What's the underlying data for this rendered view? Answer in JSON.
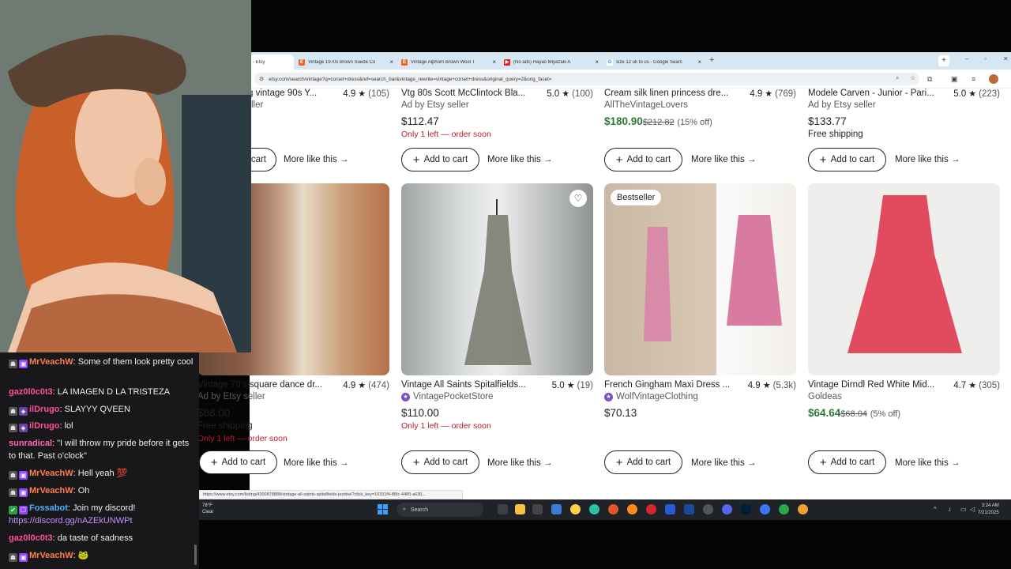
{
  "browser": {
    "tabs": [
      {
        "label": "- Etsy",
        "active": true
      },
      {
        "label": "Vintage 1970s Brown Suede Co"
      },
      {
        "label": "Vintage Alphorn Brown Wool T"
      },
      {
        "label": "(No ads) Hayao Miyazaki A"
      },
      {
        "label": "size 12 uk to us - Google Searc"
      }
    ],
    "url": "etsy.com/search/vintage?q=corset+dress&ref=search_bar&vintage_rewrite=vintage+corset+dress&original_query=2&orig_facet="
  },
  "top_row": [
    {
      "title": "g vintage 90s Y...",
      "rating": "4.9",
      "reviews": "(105)",
      "seller": "ller",
      "price": "",
      "cart": "cart",
      "more": "More like this"
    },
    {
      "title": "Vtg 80s Scott McClintock Bla...",
      "rating": "5.0",
      "reviews": "(100)",
      "seller": "Ad by Etsy seller",
      "price": "$112.47",
      "note": "Only 1 left — order soon",
      "cart": "Add to cart",
      "more": "More like this"
    },
    {
      "title": "Cream silk linen princess dre...",
      "rating": "4.9",
      "reviews": "(769)",
      "seller": "AllTheVintageLovers",
      "price": "$180.90",
      "orig": "$212.82",
      "pct": "(15% off)",
      "cart": "Add to cart",
      "more": "More like this"
    },
    {
      "title": "Modele Carven - Junior - Pari...",
      "rating": "5.0",
      "reviews": "(223)",
      "seller": "Ad by Etsy seller",
      "price": "$133.77",
      "ship": "Free shipping",
      "cart": "Add to cart",
      "more": "More like this"
    }
  ],
  "bottom_row": [
    {
      "title": "Vintage 70's square dance dr...",
      "rating": "4.9",
      "reviews": "(474)",
      "seller": "Ad by Etsy seller",
      "price": "$88.00",
      "ship": "Free shipping",
      "note": "Only 1 left — order soon",
      "cart": "Add to cart",
      "more": "More like this"
    },
    {
      "title": "Vintage All Saints Spitalfields...",
      "rating": "5.0",
      "reviews": "(19)",
      "seller": "VintagePocketStore",
      "price": "$110.00",
      "note": "Only 1 left — order soon",
      "cart": "Add to cart",
      "more": "More like this"
    },
    {
      "title": "French Gingham Maxi Dress ...",
      "rating": "4.9",
      "reviews": "(5.3k)",
      "seller": "WolfVintageClothing",
      "price": "$70.13",
      "badge": "Bestseller",
      "cart": "Add to cart",
      "more": "More like this"
    },
    {
      "title": "Vintage Dirndl Red White Mid...",
      "rating": "4.7",
      "reviews": "(305)",
      "seller": "Goldeas",
      "price": "$64.64",
      "orig": "$68.04",
      "pct": "(5% off)",
      "cart": "Add to cart",
      "more": "More like this"
    }
  ],
  "status_url": "https://www.etsy.com/listing/4300878888/vintage-all-saints-spitalfields-jezebel?click_key=10331f4-f88c-4485-a630...",
  "chat": [
    {
      "user": "MrVeachW",
      "color": "#ff7f50",
      "text": ": Some of them look pretty cool"
    },
    {
      "user": "gaz0l0c0t3",
      "color": "#ff4f9a",
      "text": ": LA IMAGEN D LA TRISTEZA"
    },
    {
      "user": "ilDrugo",
      "color": "#ff4f9a",
      "text": ": SLAYYY QVEEN"
    },
    {
      "user": "ilDrugo",
      "color": "#ff4f9a",
      "text": ": lol"
    },
    {
      "user": "sunradical",
      "color": "#ff69b4",
      "text": ": \"I will throw my pride before it gets to that. Past o'clock\""
    },
    {
      "user": "MrVeachW",
      "color": "#ff7f50",
      "text": ": Hell yeah 💯"
    },
    {
      "user": "MrVeachW",
      "color": "#ff7f50",
      "text": ": Oh"
    },
    {
      "user": "Fossabot",
      "color": "#4fb0ff",
      "text": ": Join my discord!",
      "link": "https://discord.gg/nAZEkUNWPt"
    },
    {
      "user": "gaz0l0c0t3",
      "color": "#ff4f9a",
      "text": ": da taste of sadness"
    },
    {
      "user": "MrVeachW",
      "color": "#ff7f50",
      "text": ": 🐸"
    }
  ],
  "taskbar": {
    "weather_temp": "78°F",
    "weather_cond": "Clear",
    "search": "Search",
    "time": "3:24 AM",
    "date": "7/21/2025"
  }
}
